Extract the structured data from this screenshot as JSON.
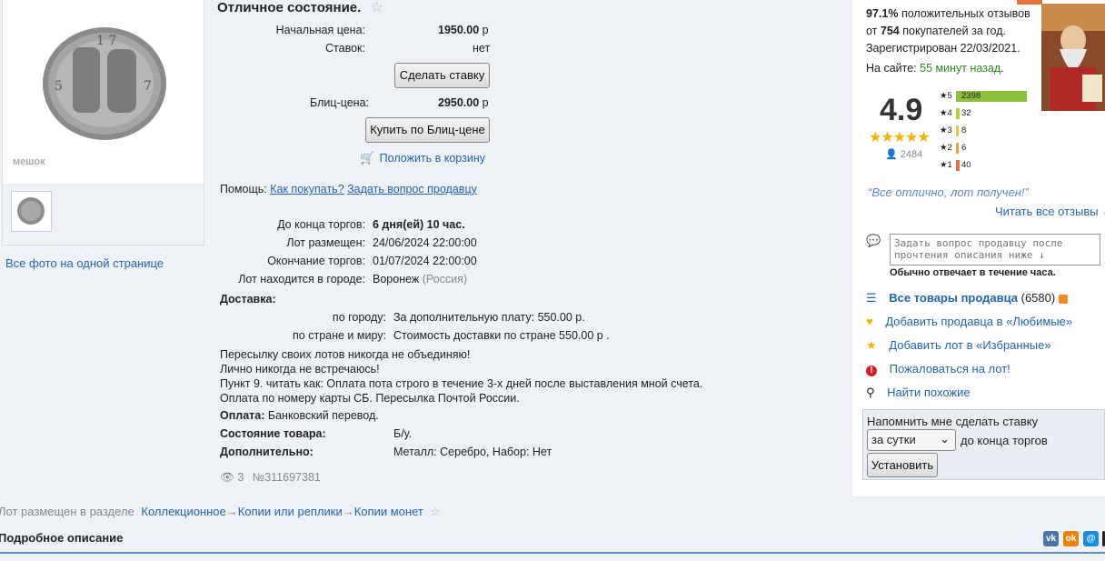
{
  "lot": {
    "condition_title": "Отличное состояние.",
    "start_price_label": "Начальная цена:",
    "start_price": "1950.00",
    "bids_label": "Ставок:",
    "bids": "нет",
    "currency": "р",
    "bid_button": "Сделать ставку",
    "blitz_label": "Блиц-цена:",
    "blitz_price": "2950.00",
    "buy_blitz_button": "Купить по Блиц-цене",
    "add_cart": "Положить в корзину",
    "help_label": "Помощь:",
    "how_to_buy": "Как покупать?",
    "ask_seller": "Задать вопрос продавцу",
    "ends_in_label": "До конца торгов:",
    "ends_in": "6 дня(ей) 10 час.",
    "placed_label": "Лот размещен:",
    "placed": "24/06/2024 22:00:00",
    "end_label": "Окончание торгов:",
    "end": "01/07/2024 22:00:00",
    "city_label": "Лот находится в городе:",
    "city": "Воронеж",
    "country": "(Россия)",
    "delivery_label": "Доставка:",
    "city_delivery_label": "по городу:",
    "city_delivery": "За дополнительную плату: 550.00 р.",
    "world_delivery_label": "по стране и миру:",
    "world_delivery": "Стоимость доставки по стране 550.00 р .",
    "notes": [
      "Пересылку своих лотов никогда не объединяю!",
      "Лично никогда не встречаюсь!",
      "Пункт 9. читать как: Оплата пота строго в течение 3-х дней после выставления мной счета.",
      "Оплата по номеру карты СБ. Пересылка Почтой России."
    ],
    "payment_label": "Оплата:",
    "payment": "Банковский перевод.",
    "state_label": "Состояние товара:",
    "state": "Б/у.",
    "extra_label": "Дополнительно:",
    "extra": "Металл: Серебро, Набор: Нет",
    "views": "3",
    "lot_number": "№311697381",
    "all_photos": "Все фото на одной странице",
    "photo_watermark": "мешок"
  },
  "breadcrumb": {
    "prefix": "Лот размещен в разделе",
    "items": [
      "Коллекционное",
      "Копии или реплики",
      "Копии монет"
    ],
    "separator": "→"
  },
  "description_title": "Подробное описание",
  "seller": {
    "positive_pct": "97.1%",
    "positive_text": "положительных отзывов",
    "from": "от",
    "buyers": "754",
    "buyers_text": "покупателей за год.",
    "registered": "Зарегистрирован 22/03/2021.",
    "online_label": "На сайте:",
    "online": "55 минут назад",
    "rating": "4.9",
    "reviews_count": "2484",
    "bars": [
      {
        "stars": "5",
        "count": "2398",
        "fraction": 1.0,
        "color": "#8bbf3a"
      },
      {
        "stars": "4",
        "count": "32",
        "fraction": 0.02,
        "color": "#b9d23c"
      },
      {
        "stars": "3",
        "count": "8",
        "fraction": 0.02,
        "color": "#e9c63a"
      },
      {
        "stars": "2",
        "count": "6",
        "fraction": 0.02,
        "color": "#f0a23a"
      },
      {
        "stars": "1",
        "count": "40",
        "fraction": 0.04,
        "color": "#e8703a"
      }
    ],
    "quote": "“Все отлично, лот получен!”",
    "read_all": "Читать все отзывы →",
    "question_placeholder": "Задать вопрос продавцу после прочтения описания ниже ↓",
    "reply_time": "Обычно отвечает в течение часа.",
    "all_items": "Все товары продавца",
    "all_items_count": "(6580)",
    "add_favorite_seller": "Добавить продавца в «Любимые»",
    "add_favorite_lot": "Добавить лот в «Избранные»",
    "complain": "Пожаловаться на лот!",
    "find_similar": "Найти похожие"
  },
  "remind": {
    "title": "Напомнить мне сделать ставку",
    "option": "за сутки",
    "suffix": "до конца торгов",
    "button": "Установить"
  },
  "colors": {
    "link": "#2264b3",
    "online": "#2a8a1e",
    "star": "#f0b400"
  }
}
